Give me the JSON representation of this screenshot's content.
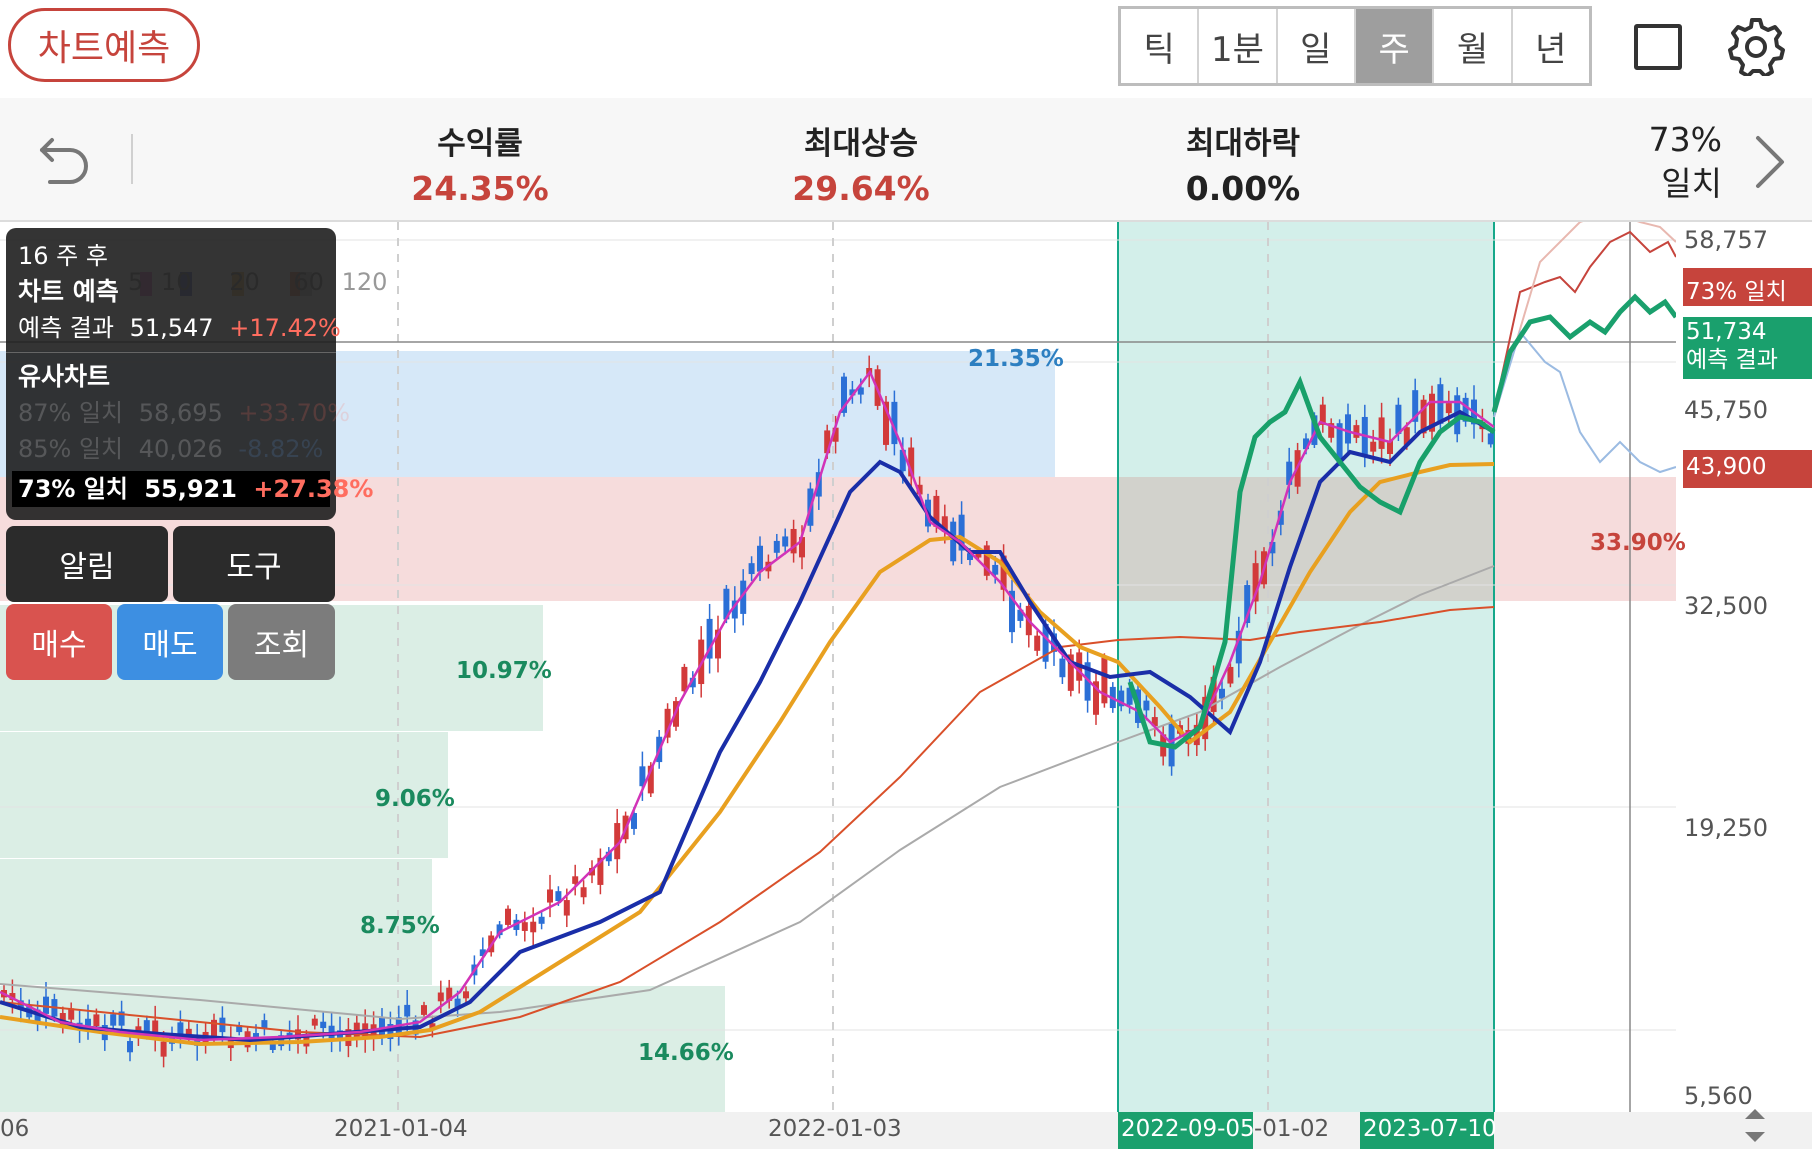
{
  "header": {
    "predict_button": "차트예측",
    "periods": [
      "틱",
      "1분",
      "일",
      "주",
      "월",
      "년"
    ],
    "active_period": "주"
  },
  "stats": {
    "return_label": "수익률",
    "return_value": "24.35%",
    "max_rise_label": "최대상승",
    "max_rise_value": "29.64%",
    "max_drop_label": "최대하락",
    "max_drop_value": "0.00%",
    "match_pct": "73%",
    "match_label": "일치"
  },
  "info_panel": {
    "weeks_after": "16 주 후",
    "title": "차트 예측",
    "result_label": "예측 결과",
    "result_price": "51,547",
    "result_change": "+17.42%",
    "similar_title": "유사차트",
    "similar": [
      {
        "match": "87% 일치",
        "price": "58,695",
        "change": "+33.70%",
        "dir": "pos",
        "dim": true
      },
      {
        "match": "85% 일치",
        "price": "40,026",
        "change": "-8.82%",
        "dir": "neg",
        "dim": true
      },
      {
        "match": "73% 일치",
        "price": "55,921",
        "change": "+27.38%",
        "dir": "pos",
        "dim": false
      }
    ]
  },
  "controls": {
    "alert": "알림",
    "tools": "도구",
    "buy": "매수",
    "sell": "매도",
    "view": "조회"
  },
  "chart_data": {
    "type": "candlestick",
    "y_axis_ticks": [
      "58,757",
      "45,750",
      "32,500",
      "19,250",
      "5,560"
    ],
    "x_axis_labels": [
      "06",
      "2021-01-04",
      "2022-01-03",
      "-01-02"
    ],
    "highlight_range": {
      "start": "2022-09-05",
      "end": "2023-07-10"
    },
    "price_labels": [
      {
        "value": "73% 일치",
        "color": "#c6443c"
      },
      {
        "value": "51,734",
        "sub": "예측 결과",
        "color": "#1aa06d"
      },
      {
        "value": "43,900",
        "color": "#c6443c"
      }
    ],
    "band_labels": [
      {
        "value": "21.35%",
        "color": "#2d7fc1"
      },
      {
        "value": "33.90%",
        "color": "#c6443c"
      }
    ],
    "volume_profile": [
      "10.97%",
      "9.06%",
      "8.75%",
      "14.66%"
    ],
    "ma_legend": [
      "5",
      "10",
      "20",
      "60",
      "120"
    ],
    "ma_colors": [
      "#d233b8",
      "#1a2ea8",
      "#e8a020",
      "#d9502a",
      "#aaaaaa"
    ],
    "candle_colors": {
      "up": "#d23a3a",
      "down": "#2b6fd6"
    }
  }
}
